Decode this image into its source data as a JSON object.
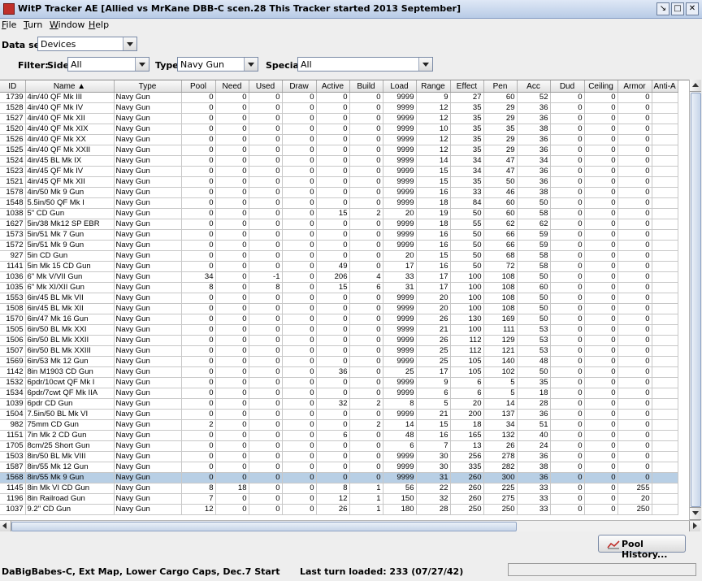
{
  "window": {
    "title": "WitP Tracker AE [Allied vs MrKane DBB-C scen.28 This Tracker started 2013 September]"
  },
  "menu": [
    "File",
    "Turn",
    "Window",
    "Help"
  ],
  "dataset": {
    "label": "Data set:",
    "value": "Devices"
  },
  "filter": {
    "label": "Filter:",
    "side_label": "Side:",
    "side_value": "All",
    "type_label": "Type:",
    "type_value": "Navy Gun",
    "special_label": "Special:",
    "special_value": "All"
  },
  "columns": [
    "ID",
    "Name ▲",
    "Type",
    "Pool",
    "Need",
    "Used",
    "Draw",
    "Active",
    "Build",
    "Load",
    "Range",
    "Effect",
    "Pen",
    "Acc",
    "Dud",
    "Ceiling",
    "Armor",
    "Anti-A"
  ],
  "rows": [
    [
      "1739",
      "4in/40 QF Mk III",
      "Navy Gun",
      "0",
      "0",
      "0",
      "0",
      "0",
      "0",
      "9999",
      "9",
      "27",
      "60",
      "52",
      "0",
      "0",
      "0",
      ""
    ],
    [
      "1528",
      "4in/40 QF Mk IV",
      "Navy Gun",
      "0",
      "0",
      "0",
      "0",
      "0",
      "0",
      "9999",
      "12",
      "35",
      "29",
      "36",
      "0",
      "0",
      "0",
      ""
    ],
    [
      "1527",
      "4in/40 QF Mk XII",
      "Navy Gun",
      "0",
      "0",
      "0",
      "0",
      "0",
      "0",
      "9999",
      "12",
      "35",
      "29",
      "36",
      "0",
      "0",
      "0",
      ""
    ],
    [
      "1520",
      "4in/40 QF Mk XIX",
      "Navy Gun",
      "0",
      "0",
      "0",
      "0",
      "0",
      "0",
      "9999",
      "10",
      "35",
      "35",
      "38",
      "0",
      "0",
      "0",
      ""
    ],
    [
      "1526",
      "4in/40 QF Mk XX",
      "Navy Gun",
      "0",
      "0",
      "0",
      "0",
      "0",
      "0",
      "9999",
      "12",
      "35",
      "29",
      "36",
      "0",
      "0",
      "0",
      ""
    ],
    [
      "1525",
      "4in/40 QF Mk XXII",
      "Navy Gun",
      "0",
      "0",
      "0",
      "0",
      "0",
      "0",
      "9999",
      "12",
      "35",
      "29",
      "36",
      "0",
      "0",
      "0",
      ""
    ],
    [
      "1524",
      "4in/45 BL Mk IX",
      "Navy Gun",
      "0",
      "0",
      "0",
      "0",
      "0",
      "0",
      "9999",
      "14",
      "34",
      "47",
      "34",
      "0",
      "0",
      "0",
      ""
    ],
    [
      "1523",
      "4in/45 QF Mk IV",
      "Navy Gun",
      "0",
      "0",
      "0",
      "0",
      "0",
      "0",
      "9999",
      "15",
      "34",
      "47",
      "36",
      "0",
      "0",
      "0",
      ""
    ],
    [
      "1521",
      "4in/45 QF Mk XII",
      "Navy Gun",
      "0",
      "0",
      "0",
      "0",
      "0",
      "0",
      "9999",
      "15",
      "35",
      "50",
      "36",
      "0",
      "0",
      "0",
      ""
    ],
    [
      "1578",
      "4in/50 Mk 9 Gun",
      "Navy Gun",
      "0",
      "0",
      "0",
      "0",
      "0",
      "0",
      "9999",
      "16",
      "33",
      "46",
      "38",
      "0",
      "0",
      "0",
      ""
    ],
    [
      "1548",
      "5.5in/50 QF Mk I",
      "Navy Gun",
      "0",
      "0",
      "0",
      "0",
      "0",
      "0",
      "9999",
      "18",
      "84",
      "60",
      "50",
      "0",
      "0",
      "0",
      ""
    ],
    [
      "1038",
      "5\" CD Gun",
      "Navy Gun",
      "0",
      "0",
      "0",
      "0",
      "15",
      "2",
      "20",
      "19",
      "50",
      "60",
      "58",
      "0",
      "0",
      "0",
      ""
    ],
    [
      "1627",
      "5in/38 Mk12 SP EBR",
      "Navy Gun",
      "0",
      "0",
      "0",
      "0",
      "0",
      "0",
      "9999",
      "18",
      "55",
      "62",
      "62",
      "0",
      "0",
      "0",
      ""
    ],
    [
      "1573",
      "5in/51 Mk 7 Gun",
      "Navy Gun",
      "0",
      "0",
      "0",
      "0",
      "0",
      "0",
      "9999",
      "16",
      "50",
      "66",
      "59",
      "0",
      "0",
      "0",
      ""
    ],
    [
      "1572",
      "5in/51 Mk 9 Gun",
      "Navy Gun",
      "0",
      "0",
      "0",
      "0",
      "0",
      "0",
      "9999",
      "16",
      "50",
      "66",
      "59",
      "0",
      "0",
      "0",
      ""
    ],
    [
      "927",
      "5in CD Gun",
      "Navy Gun",
      "0",
      "0",
      "0",
      "0",
      "0",
      "0",
      "20",
      "15",
      "50",
      "68",
      "58",
      "0",
      "0",
      "0",
      ""
    ],
    [
      "1141",
      "5in Mk 15 CD Gun",
      "Navy Gun",
      "0",
      "0",
      "0",
      "0",
      "49",
      "0",
      "17",
      "16",
      "50",
      "72",
      "58",
      "0",
      "0",
      "0",
      ""
    ],
    [
      "1036",
      "6\" Mk V/VII Gun",
      "Navy Gun",
      "34",
      "0",
      "-1",
      "0",
      "206",
      "4",
      "33",
      "17",
      "100",
      "108",
      "50",
      "0",
      "0",
      "0",
      ""
    ],
    [
      "1035",
      "6\" Mk XI/XII Gun",
      "Navy Gun",
      "8",
      "0",
      "8",
      "0",
      "15",
      "6",
      "31",
      "17",
      "100",
      "108",
      "60",
      "0",
      "0",
      "0",
      ""
    ],
    [
      "1553",
      "6in/45 BL Mk VII",
      "Navy Gun",
      "0",
      "0",
      "0",
      "0",
      "0",
      "0",
      "9999",
      "20",
      "100",
      "108",
      "50",
      "0",
      "0",
      "0",
      ""
    ],
    [
      "1508",
      "6in/45 BL Mk XII",
      "Navy Gun",
      "0",
      "0",
      "0",
      "0",
      "0",
      "0",
      "9999",
      "20",
      "100",
      "108",
      "50",
      "0",
      "0",
      "0",
      ""
    ],
    [
      "1570",
      "6in/47 Mk 16 Gun",
      "Navy Gun",
      "0",
      "0",
      "0",
      "0",
      "0",
      "0",
      "9999",
      "26",
      "130",
      "169",
      "50",
      "0",
      "0",
      "0",
      ""
    ],
    [
      "1505",
      "6in/50 BL Mk XXI",
      "Navy Gun",
      "0",
      "0",
      "0",
      "0",
      "0",
      "0",
      "9999",
      "21",
      "100",
      "111",
      "53",
      "0",
      "0",
      "0",
      ""
    ],
    [
      "1506",
      "6in/50 BL Mk XXII",
      "Navy Gun",
      "0",
      "0",
      "0",
      "0",
      "0",
      "0",
      "9999",
      "26",
      "112",
      "129",
      "53",
      "0",
      "0",
      "0",
      ""
    ],
    [
      "1507",
      "6in/50 BL Mk XXIII",
      "Navy Gun",
      "0",
      "0",
      "0",
      "0",
      "0",
      "0",
      "9999",
      "25",
      "112",
      "121",
      "53",
      "0",
      "0",
      "0",
      ""
    ],
    [
      "1569",
      "6in/53 Mk 12 Gun",
      "Navy Gun",
      "0",
      "0",
      "0",
      "0",
      "0",
      "0",
      "9999",
      "25",
      "105",
      "140",
      "48",
      "0",
      "0",
      "0",
      ""
    ],
    [
      "1142",
      "8in M1903 CD Gun",
      "Navy Gun",
      "0",
      "0",
      "0",
      "0",
      "36",
      "0",
      "25",
      "17",
      "105",
      "102",
      "50",
      "0",
      "0",
      "0",
      ""
    ],
    [
      "1532",
      "6pdr/10cwt QF Mk I",
      "Navy Gun",
      "0",
      "0",
      "0",
      "0",
      "0",
      "0",
      "9999",
      "9",
      "6",
      "5",
      "35",
      "0",
      "0",
      "0",
      ""
    ],
    [
      "1534",
      "6pdr/7cwt QF Mk IIA",
      "Navy Gun",
      "0",
      "0",
      "0",
      "0",
      "0",
      "0",
      "9999",
      "6",
      "6",
      "5",
      "18",
      "0",
      "0",
      "0",
      ""
    ],
    [
      "1039",
      "6pdr CD Gun",
      "Navy Gun",
      "0",
      "0",
      "0",
      "0",
      "32",
      "2",
      "8",
      "5",
      "20",
      "14",
      "28",
      "0",
      "0",
      "0",
      ""
    ],
    [
      "1504",
      "7.5in/50 BL Mk VI",
      "Navy Gun",
      "0",
      "0",
      "0",
      "0",
      "0",
      "0",
      "9999",
      "21",
      "200",
      "137",
      "36",
      "0",
      "0",
      "0",
      ""
    ],
    [
      "982",
      "75mm CD Gun",
      "Navy Gun",
      "2",
      "0",
      "0",
      "0",
      "0",
      "2",
      "14",
      "15",
      "18",
      "34",
      "51",
      "0",
      "0",
      "0",
      ""
    ],
    [
      "1151",
      "7in Mk 2 CD Gun",
      "Navy Gun",
      "0",
      "0",
      "0",
      "0",
      "6",
      "0",
      "48",
      "16",
      "165",
      "132",
      "40",
      "0",
      "0",
      "0",
      ""
    ],
    [
      "1705",
      "8cm/25 Short Gun",
      "Navy Gun",
      "0",
      "0",
      "0",
      "0",
      "0",
      "0",
      "6",
      "7",
      "13",
      "26",
      "24",
      "0",
      "0",
      "0",
      ""
    ],
    [
      "1503",
      "8in/50 BL Mk VIII",
      "Navy Gun",
      "0",
      "0",
      "0",
      "0",
      "0",
      "0",
      "9999",
      "30",
      "256",
      "278",
      "36",
      "0",
      "0",
      "0",
      ""
    ],
    [
      "1587",
      "8in/55 Mk 12 Gun",
      "Navy Gun",
      "0",
      "0",
      "0",
      "0",
      "0",
      "0",
      "9999",
      "30",
      "335",
      "282",
      "38",
      "0",
      "0",
      "0",
      ""
    ],
    [
      "1568",
      "8in/55 Mk 9 Gun",
      "Navy Gun",
      "0",
      "0",
      "0",
      "0",
      "0",
      "0",
      "9999",
      "31",
      "260",
      "300",
      "36",
      "0",
      "0",
      "0",
      ""
    ],
    [
      "1145",
      "8in Mk VI CD Gun",
      "Navy Gun",
      "8",
      "18",
      "0",
      "0",
      "8",
      "1",
      "56",
      "22",
      "260",
      "225",
      "33",
      "0",
      "0",
      "255",
      ""
    ],
    [
      "1196",
      "8in Railroad Gun",
      "Navy Gun",
      "7",
      "0",
      "0",
      "0",
      "12",
      "1",
      "150",
      "32",
      "260",
      "275",
      "33",
      "0",
      "0",
      "20",
      ""
    ],
    [
      "1037",
      "9.2\" CD Gun",
      "Navy Gun",
      "12",
      "0",
      "0",
      "0",
      "26",
      "1",
      "180",
      "28",
      "250",
      "250",
      "33",
      "0",
      "0",
      "250",
      ""
    ]
  ],
  "selected_row_id": "1568",
  "pool_history_button": "Pool History...",
  "status": {
    "left": "DaBigBabes-C, Ext Map, Lower Cargo Caps, Dec.7 Start",
    "center": "Last turn loaded: 233 (07/27/42)"
  }
}
